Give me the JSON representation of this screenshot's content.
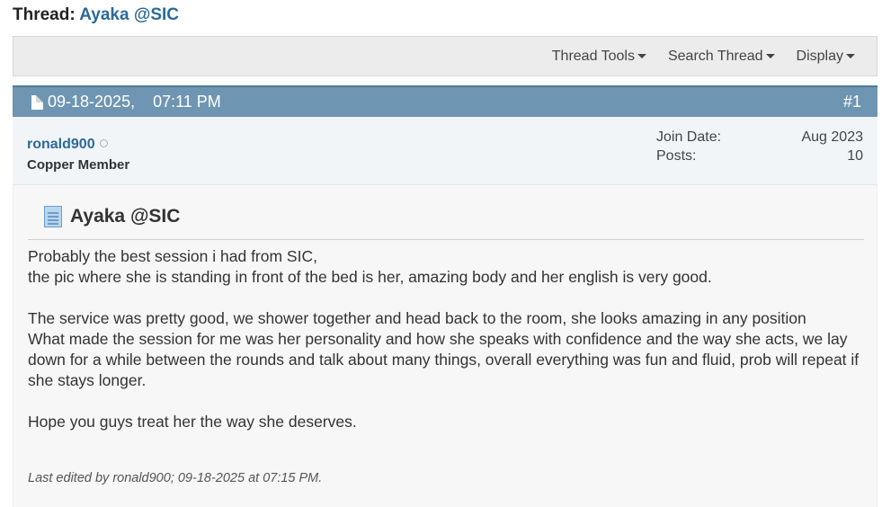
{
  "thread": {
    "prefix": "Thread:",
    "title": "Ayaka @SIC"
  },
  "toolbar": {
    "thread_tools": "Thread Tools",
    "search_thread": "Search Thread",
    "display": "Display"
  },
  "post": {
    "date": "09-18-2025,",
    "time": "07:11 PM",
    "number": "#1",
    "username": "ronald900",
    "user_title": "Copper Member",
    "join_date_label": "Join Date:",
    "join_date_value": "Aug 2023",
    "posts_label": "Posts:",
    "posts_value": "10",
    "title": "Ayaka @SIC",
    "paragraphs": [
      "Probably the best session i had from SIC,",
      "the pic where she is standing in front of the bed is her, amazing body and her english is very good.",
      "",
      "The service was pretty good, we shower together and head back to the room, she looks amazing in any position",
      "What made the session for me was her personality and how she speaks with confidence and the way she acts, we lay down for a while between the rounds and talk about many things, overall everything was fun and fluid, prob will repeat if she stays longer.",
      "",
      "Hope you guys treat her the way she deserves."
    ],
    "edited_note": "Last edited by ronald900; 09-18-2025 at 07:15 PM."
  },
  "colors": {
    "link": "#2b6a99",
    "post_header": "#6e96b2",
    "userbar": "#f2f5f8"
  }
}
